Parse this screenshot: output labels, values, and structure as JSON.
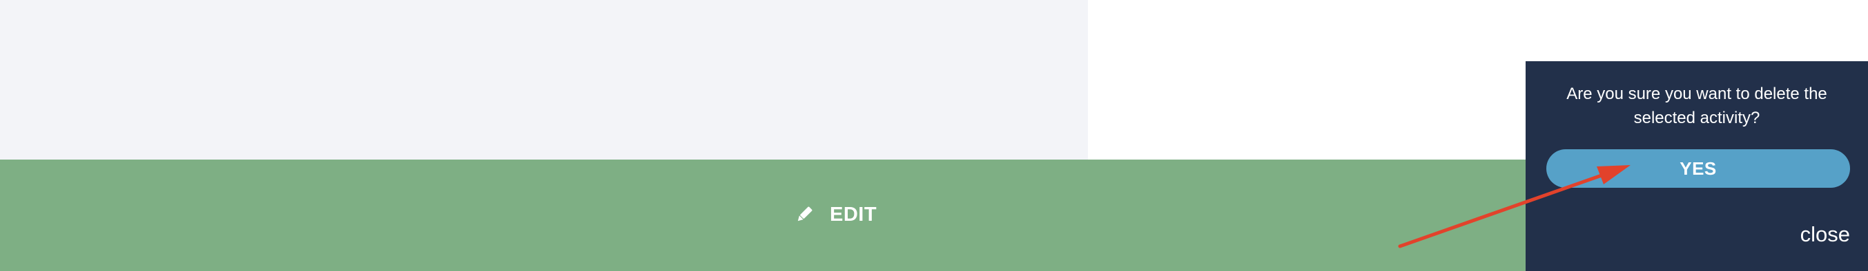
{
  "edit_bar": {
    "icon": "pencil-icon",
    "label": "EDIT"
  },
  "confirm_dialog": {
    "message": "Are you sure you want to delete the selected activity?",
    "confirm_label": "YES",
    "close_label": "close"
  },
  "colors": {
    "background_left": "#f3f4f8",
    "edit_bar": "#7eaf84",
    "popover": "#22304a",
    "confirm_button": "#56a1c8",
    "annotation_arrow": "#e2422b"
  }
}
